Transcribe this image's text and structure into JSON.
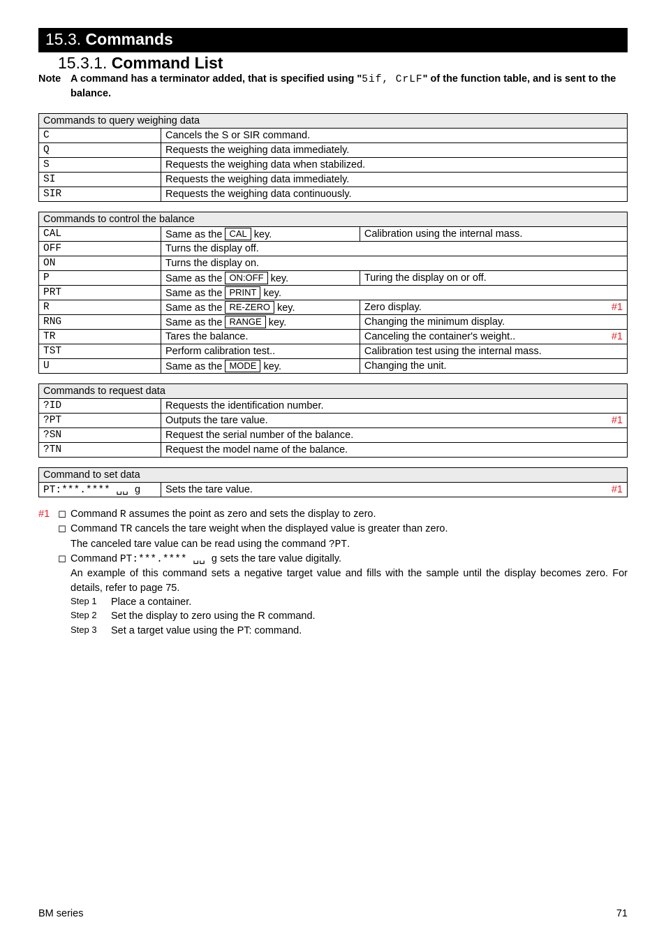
{
  "section": {
    "num": "15.3.",
    "label": "Commands"
  },
  "subsection": {
    "num": "15.3.1.",
    "label": "Command List"
  },
  "note": {
    "label": "Note",
    "text_a": "A command has a terminator added, that is specified using \"",
    "seg": "5if, CrLF",
    "text_b": "\" of the function table, and is sent to the balance."
  },
  "query": {
    "title": "Commands to query weighing data",
    "rows": [
      {
        "c": "C",
        "d": "Cancels the S or SIR command."
      },
      {
        "c": "Q",
        "d": "Requests the weighing data immediately."
      },
      {
        "c": "S",
        "d": "Requests the weighing data when stabilized."
      },
      {
        "c": "SI",
        "d": "Requests the weighing data immediately."
      },
      {
        "c": "SIR",
        "d": "Requests the weighing data continuously."
      }
    ]
  },
  "control": {
    "title": "Commands to control the balance",
    "rows": [
      {
        "c": "CAL",
        "pre": "Same as the ",
        "key": "CAL",
        "post": " key.",
        "r": "Calibration using the internal mass.",
        "tag": ""
      },
      {
        "c": "OFF",
        "d": "Turns the display off."
      },
      {
        "c": "ON",
        "d": "Turns the display on."
      },
      {
        "c": "P",
        "pre": "Same as the ",
        "key": "ON:OFF",
        "post": " key.",
        "r": "Turing the display on or off.",
        "tag": ""
      },
      {
        "c": "PRT",
        "pre": "Same as the ",
        "key": "PRINT",
        "post": " key."
      },
      {
        "c": "R",
        "pre": "Same as the ",
        "key": "RE-ZERO",
        "post": " key.",
        "r": "Zero display.",
        "tag": "#1"
      },
      {
        "c": "RNG",
        "pre": "Same as the ",
        "key": "RANGE",
        "post": " key.",
        "r": "Changing the minimum display.",
        "tag": ""
      },
      {
        "c": "TR",
        "d": "Tares the balance.",
        "r": "Canceling the container's weight..",
        "tag": "#1"
      },
      {
        "c": "TST",
        "d": "Perform calibration test..",
        "r": "Calibration test using the internal mass.",
        "tag": ""
      },
      {
        "c": "U",
        "pre": "Same as the ",
        "key": "MODE",
        "post": " key.",
        "r": "Changing the unit.",
        "tag": ""
      }
    ]
  },
  "request": {
    "title": "Commands to request data",
    "rows": [
      {
        "c": "?ID",
        "d": "Requests the identification number.",
        "tag": ""
      },
      {
        "c": "?PT",
        "d": "Outputs the tare value.",
        "tag": "#1"
      },
      {
        "c": "?SN",
        "d": "Request the serial number of the balance.",
        "tag": ""
      },
      {
        "c": "?TN",
        "d": "Request the model name of the balance.",
        "tag": ""
      }
    ]
  },
  "set": {
    "title": "Command to set data",
    "row": {
      "c": "PT:***.**** ␣␣ g",
      "d": "Sets the tare value.",
      "tag": "#1"
    }
  },
  "notes": {
    "tag": "#1",
    "b1": {
      "pre": "Command ",
      "code": "R",
      "post": " assumes the point as zero and sets the display to zero."
    },
    "b2": {
      "l1pre": "Command ",
      "l1code": "TR",
      "l1post": " cancels the tare weight when the displayed value is greater than zero.",
      "l2pre": "The canceled tare value can be read using the command ",
      "l2code": "?PT",
      "l2post": "."
    },
    "b3": {
      "l1pre": "Command ",
      "l1code": "PT:***.**** ␣␣ g",
      "l1post": " sets the tare value digitally.",
      "l2": "An example of this command sets a negative target value and fills with the sample until the display becomes zero. For details, refer to page 75."
    },
    "steps": [
      {
        "lbl": "Step 1",
        "txt": "Place a container."
      },
      {
        "lbl": "Step 2",
        "txt": "Set the display to zero using the R command."
      },
      {
        "lbl": "Step 3",
        "txt": "Set a target value using the PT: command."
      }
    ]
  },
  "footer": {
    "left": "BM series",
    "right": "71"
  }
}
